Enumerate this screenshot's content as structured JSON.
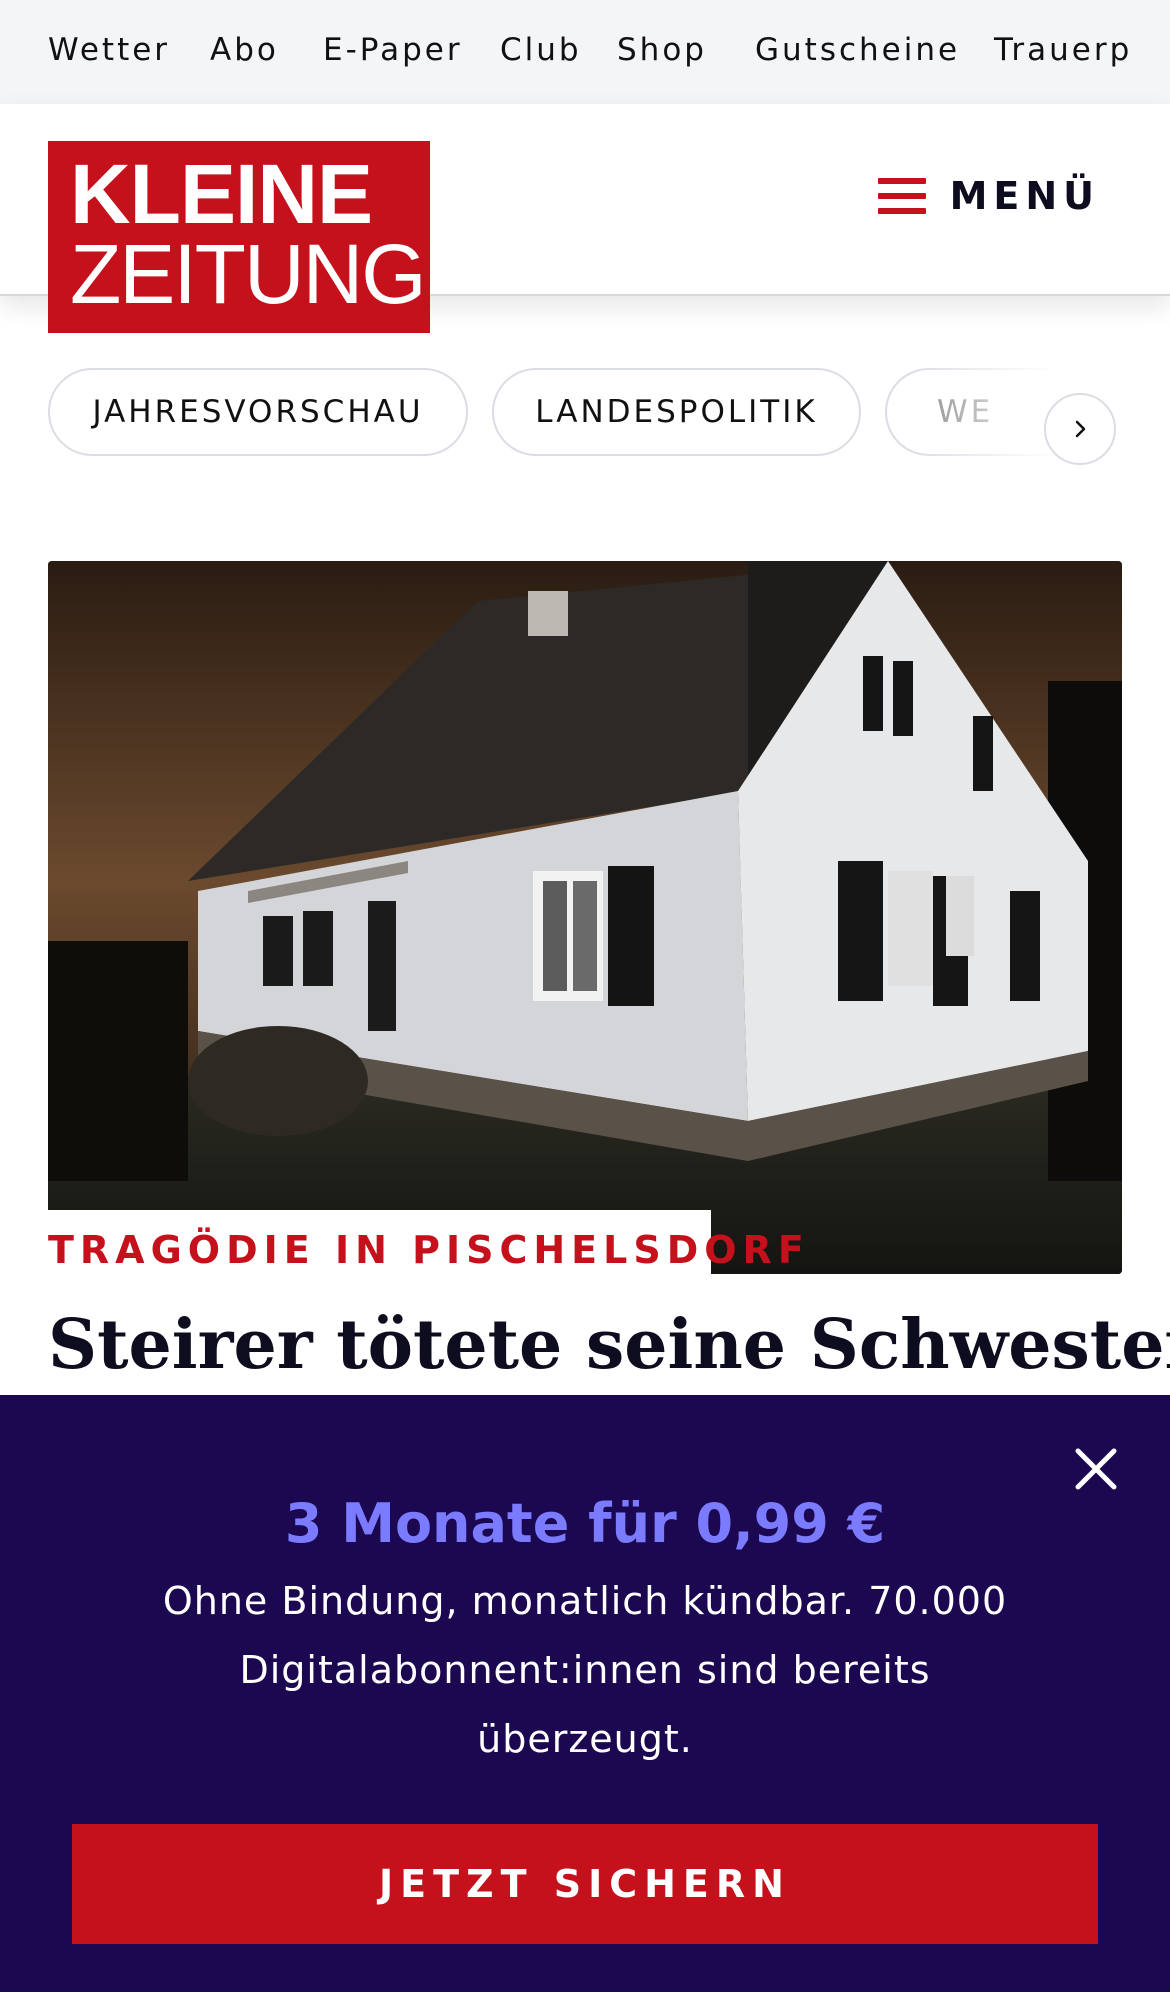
{
  "topnav": [
    "Wetter",
    "Abo",
    "E-Paper",
    "Club",
    "Shop",
    "Gutscheine",
    "Trauerp"
  ],
  "logo": {
    "line1": "KLEINE",
    "line2": "ZEITUNG"
  },
  "header": {
    "menu_label": "MENÜ"
  },
  "chips": [
    "JAHRESVORSCHAU",
    "LANDESPOLITIK",
    "WE"
  ],
  "article": {
    "kicker": "TRAGÖDIE IN PISCHELSDORF",
    "headline": "Steirer tötete seine Schwester"
  },
  "promo": {
    "title": "3 Monate für 0,99 €",
    "subtitle": "Ohne Bindung, monatlich kündbar. 70.000 Digitalabonnent:innen sind bereits überzeugt.",
    "cta": "JETZT SICHERN"
  },
  "colors": {
    "brand_red": "#c4111b",
    "promo_bg": "#1c0850",
    "promo_accent": "#7b7bff"
  }
}
